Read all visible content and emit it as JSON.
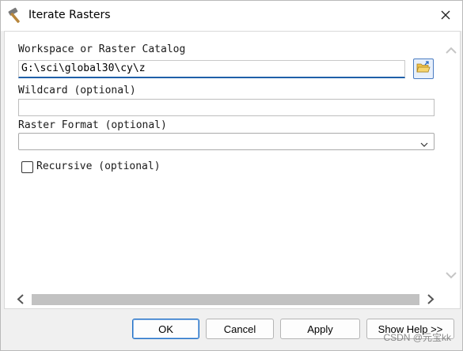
{
  "window": {
    "title": "Iterate Rasters",
    "title_icon": "hammer-icon",
    "close_icon": "close-icon"
  },
  "form": {
    "workspace": {
      "label": "Workspace or Raster Catalog",
      "value": "G:\\sci\\global30\\cy\\z",
      "browse_icon": "open-folder-icon"
    },
    "wildcard": {
      "label": "Wildcard (optional)",
      "value": ""
    },
    "raster_format": {
      "label": "Raster Format (optional)",
      "selected": ""
    },
    "recursive": {
      "label": "Recursive (optional)",
      "checked": false
    }
  },
  "buttons": {
    "ok": "OK",
    "cancel": "Cancel",
    "apply": "Apply",
    "show_help": "Show Help >>"
  },
  "watermark": "CSDN @元宝kk",
  "colors": {
    "accent": "#1f5fa8",
    "primary_button_border": "#1f6fc5",
    "scroll_track": "#c2c2c2"
  }
}
